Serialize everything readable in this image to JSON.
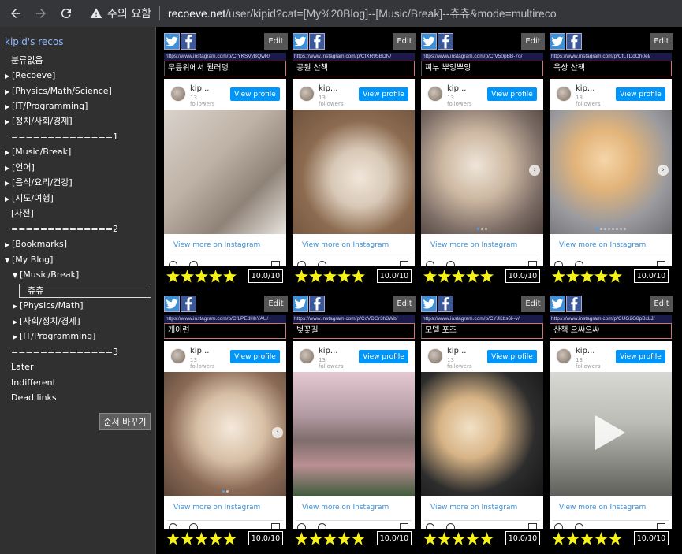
{
  "browser": {
    "warning_text": "주의 요함",
    "url_host": "recoeve.net",
    "url_path": "/user/kipid?cat=[My%20Blog]--[Music/Break]--츄츄&mode=multireco"
  },
  "sidebar": {
    "title": "kipid's recos",
    "order_button": "순서 바꾸기",
    "items": [
      {
        "label": "분류없음",
        "tri": ""
      },
      {
        "label": "[Recoeve]",
        "tri": "▶"
      },
      {
        "label": "[Physics/Math/Science]",
        "tri": "▶"
      },
      {
        "label": "[IT/Programming]",
        "tri": "▶"
      },
      {
        "label": "[정치/사회/경제]",
        "tri": "▶"
      },
      {
        "label": "==============1",
        "tri": ""
      },
      {
        "label": "[Music/Break]",
        "tri": "▶"
      },
      {
        "label": "[언어]",
        "tri": "▶"
      },
      {
        "label": "[음식/요리/건강]",
        "tri": "▶"
      },
      {
        "label": "[지도/여행]",
        "tri": "▶"
      },
      {
        "label": "[사전]",
        "tri": ""
      },
      {
        "label": "==============2",
        "tri": ""
      },
      {
        "label": "[Bookmarks]",
        "tri": "▶"
      },
      {
        "label": "[My Blog]",
        "tri": "▼"
      },
      {
        "label": "[Music/Break]",
        "tri": "▼"
      },
      {
        "label": "츄츄",
        "tri": ""
      },
      {
        "label": "[Physics/Math]",
        "tri": "▶"
      },
      {
        "label": "[사회/정치/경제]",
        "tri": "▶"
      },
      {
        "label": "[IT/Programming]",
        "tri": "▶"
      },
      {
        "label": "==============3",
        "tri": ""
      },
      {
        "label": "Later",
        "tri": ""
      },
      {
        "label": "Indifferent",
        "tri": ""
      },
      {
        "label": "Dead links",
        "tri": ""
      }
    ]
  },
  "common": {
    "edit": "Edit",
    "username": "kip...",
    "followers_count": "13",
    "followers_label": "followers",
    "view_profile": "View profile",
    "view_more": "View more on Instagram",
    "score": "10.0/10",
    "stars": 5
  },
  "cards": [
    {
      "link": "https://www.instagram.com/p/CfYKSVyBQwR/",
      "title": "무릎위에서 뒬러덩"
    },
    {
      "link": "https://www.instagram.com/p/CfXR95BDN/",
      "title": "공원 산책"
    },
    {
      "link": "https://www.instagram.com/p/CfV50pBB-7o/",
      "title": "찌부 뿌잉뿌잉"
    },
    {
      "link": "https://www.instagram.com/p/CfLTDdOh0el/",
      "title": "옥상 산책"
    },
    {
      "link": "https://www.instagram.com/p/CfLPEdHhYAU/",
      "title": "개아련"
    },
    {
      "link": "https://www.instagram.com/p/CcVDGr3h3Wb/",
      "title": "벚꽃길"
    },
    {
      "link": "https://www.instagram.com/p/CYJKbs6l--v/",
      "title": "모델 포즈"
    },
    {
      "link": "https://www.instagram.com/p/CUG2G8pBxLJ/",
      "title": "산책 으쌰으쌰"
    }
  ]
}
